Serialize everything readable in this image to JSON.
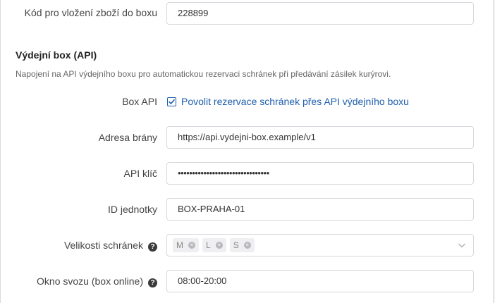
{
  "form": {
    "product_code": {
      "label": "Kód pro vložení zboží do boxu",
      "value": "228899"
    },
    "section": {
      "title": "Výdejní box (API)",
      "description": "Napojení na API výdejního boxu pro automatickou rezervaci schránek při předávání zásilek kurýrovi."
    },
    "box_api": {
      "label": "Box API",
      "checkbox_label": "Povolit rezervace schránek přes API výdejního boxu",
      "checked": true
    },
    "gateway": {
      "label": "Adresa brány",
      "value": "https://api.vydejni-box.example/v1"
    },
    "api_key": {
      "label": "API klíč",
      "value": "••••••••••••••••••••••••••••••••"
    },
    "unit_id": {
      "label": "ID jednotky",
      "value": "BOX-PRAHA-01"
    },
    "sizes": {
      "label": "Velikosti schránek",
      "tags": [
        "M",
        "L",
        "S"
      ]
    },
    "window": {
      "label": "Okno svozu (box online)",
      "value": "08:00-20:00"
    }
  },
  "icons": {
    "help": "question-circle-icon",
    "remove": "close-circle-icon",
    "dropdown": "chevron-down-icon",
    "check": "checkmark-icon"
  },
  "colors": {
    "accent": "#1f5fae",
    "border": "#d5d8dc"
  }
}
